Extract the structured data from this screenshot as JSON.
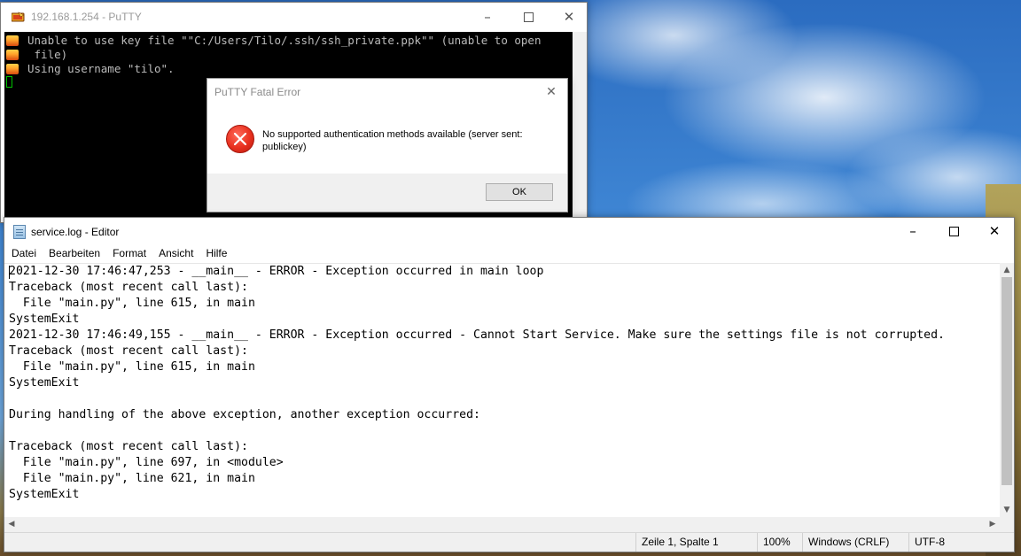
{
  "putty": {
    "title": "192.168.1.254 - PuTTY",
    "terminal_lines": [
      "Unable to use key file \"\"C:/Users/Tilo/.ssh/ssh_private.ppk\"\" (unable to open",
      " file)",
      "Using username \"tilo\"."
    ]
  },
  "dialog": {
    "title": "PuTTY Fatal Error",
    "message": "No supported authentication methods available (server sent: publickey)",
    "ok_label": "OK"
  },
  "editor": {
    "title": "service.log - Editor",
    "menu": [
      "Datei",
      "Bearbeiten",
      "Format",
      "Ansicht",
      "Hilfe"
    ],
    "lines": [
      "2021-12-30 17:46:47,253 - __main__ - ERROR - Exception occurred in main loop",
      "Traceback (most recent call last):",
      "  File \"main.py\", line 615, in main",
      "SystemExit",
      "2021-12-30 17:46:49,155 - __main__ - ERROR - Exception occurred - Cannot Start Service. Make sure the settings file is not corrupted.",
      "Traceback (most recent call last):",
      "  File \"main.py\", line 615, in main",
      "SystemExit",
      "",
      "During handling of the above exception, another exception occurred:",
      "",
      "Traceback (most recent call last):",
      "  File \"main.py\", line 697, in <module>",
      "  File \"main.py\", line 621, in main",
      "SystemExit"
    ],
    "status": {
      "position": "Zeile 1, Spalte 1",
      "zoom": "100%",
      "line_ending": "Windows (CRLF)",
      "encoding": "UTF-8"
    }
  },
  "icons": {
    "putty_app": "putty-icon",
    "notepad_app": "notepad-icon",
    "error": "error-icon",
    "minimize": "minimize-icon",
    "maximize": "maximize-icon",
    "close": "close-icon"
  },
  "colors": {
    "terminal_bg": "#000000",
    "terminal_text": "#bbbbbb",
    "cursor": "#00c000",
    "error_red": "#e8301e"
  }
}
